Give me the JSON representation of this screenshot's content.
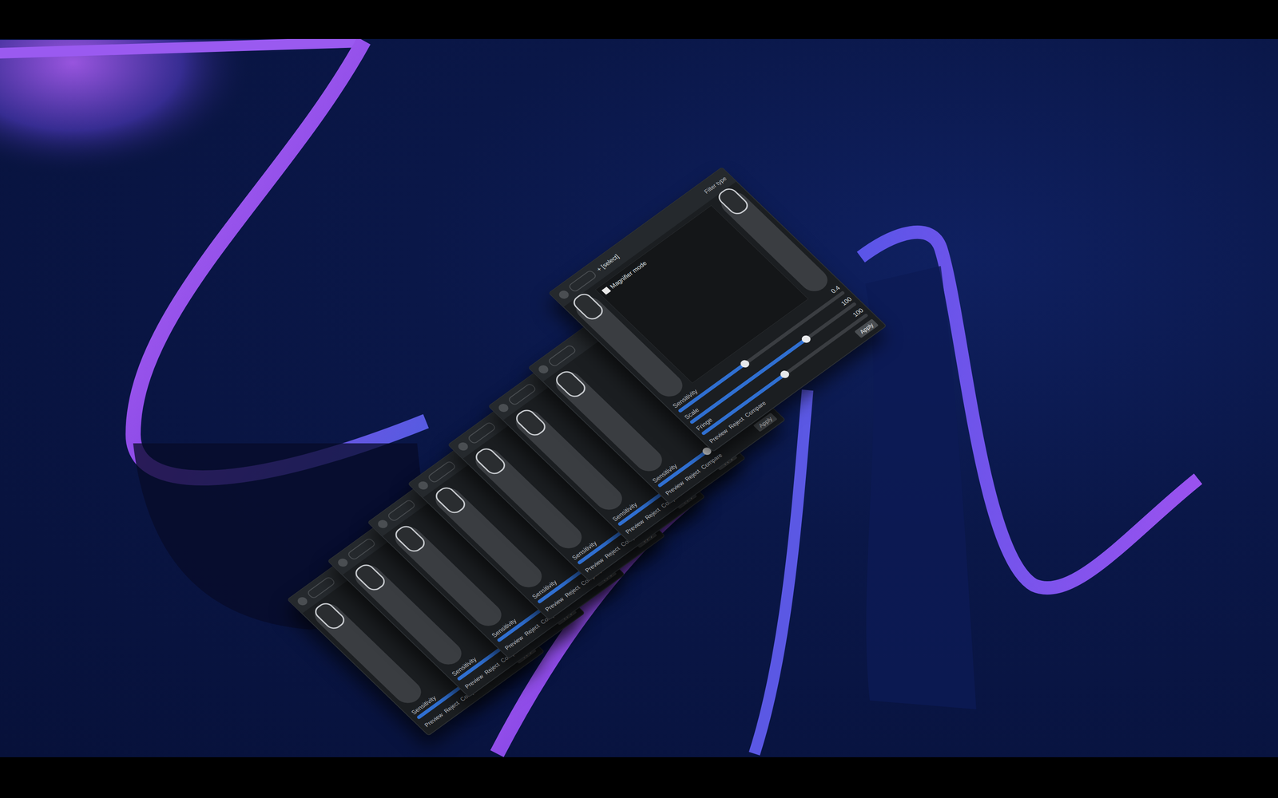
{
  "scene": {
    "letterbox": true
  },
  "panels": [
    {
      "kind": "compact",
      "vertical_level": 0.92,
      "sliders": [
        {
          "label": "Sensitivity",
          "level": 0.45,
          "reading": ""
        }
      ],
      "buttons": [
        "Preview",
        "Reject"
      ],
      "menu": "Compare",
      "action": "Apply"
    },
    {
      "kind": "compact",
      "vertical_level": 0.92,
      "sliders": [
        {
          "label": "Sensitivity",
          "level": 0.45,
          "reading": ""
        }
      ],
      "buttons": [
        "Preview",
        "Reject"
      ],
      "menu": "Compare",
      "action": "Apply"
    },
    {
      "kind": "compact",
      "vertical_level": 0.92,
      "sliders": [
        {
          "label": "Sensitivity",
          "level": 0.45,
          "reading": ""
        }
      ],
      "buttons": [
        "Preview",
        "Reject"
      ],
      "menu": "Compare",
      "action": "Apply"
    },
    {
      "kind": "compact",
      "vertical_level": 0.92,
      "sliders": [
        {
          "label": "Sensitivity",
          "level": 0.45,
          "reading": ""
        }
      ],
      "buttons": [
        "Preview",
        "Reject"
      ],
      "menu": "Compare",
      "action": "Apply"
    },
    {
      "kind": "compact",
      "vertical_level": 0.92,
      "sliders": [
        {
          "label": "Sensitivity",
          "level": 0.45,
          "reading": ""
        }
      ],
      "buttons": [
        "Preview",
        "Reject"
      ],
      "menu": "Compare",
      "action": "Apply"
    },
    {
      "kind": "compact",
      "vertical_level": 0.92,
      "sliders": [
        {
          "label": "Sensitivity",
          "level": 0.45,
          "reading": ""
        }
      ],
      "buttons": [
        "Preview",
        "Reject"
      ],
      "menu": "Compare",
      "action": "Apply"
    },
    {
      "kind": "compact",
      "vertical_level": 0.92,
      "sliders": [
        {
          "label": "Sensitivity",
          "level": 0.45,
          "reading": ""
        }
      ],
      "buttons": [
        "Preview",
        "Reject"
      ],
      "menu": "Compare",
      "action": "Apply"
    },
    {
      "kind": "full",
      "title": "+ [select]",
      "mode": "Magnifier mode",
      "filter": "Filter type",
      "vertical_level": 0.95,
      "right_level": 0.95,
      "sliders": [
        {
          "label": "Sensitivity",
          "level": 0.4,
          "reading": "0.4"
        },
        {
          "label": "Scale",
          "level": 0.7,
          "reading": "100"
        },
        {
          "label": "Fringe",
          "level": 0.5,
          "reading": "100"
        }
      ],
      "buttons": [
        "Preview",
        "Reject"
      ],
      "menu": "Compare",
      "action": "Apply"
    }
  ]
}
